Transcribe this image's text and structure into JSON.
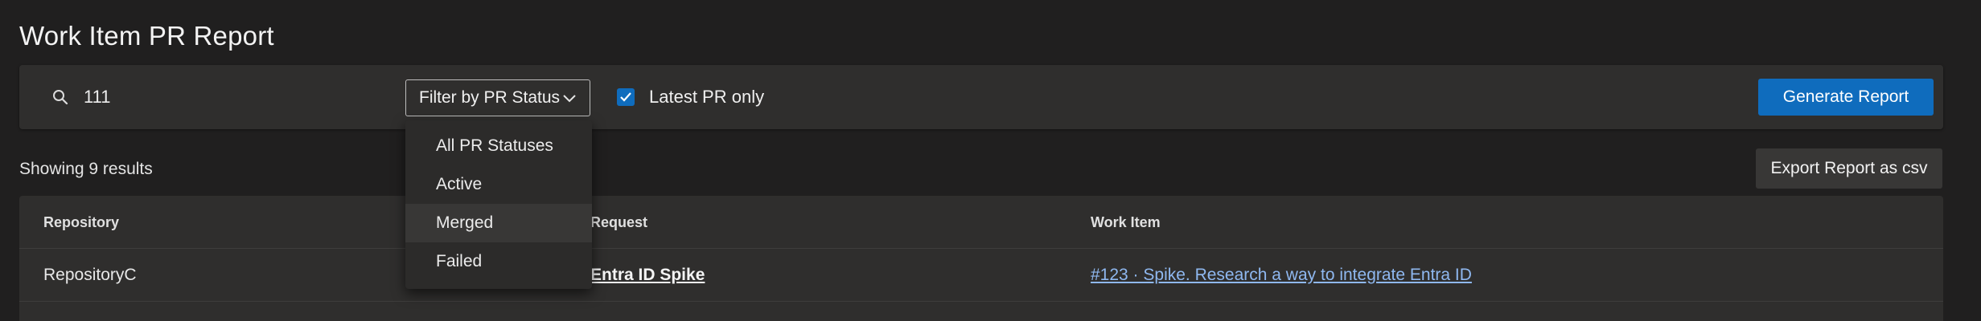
{
  "page": {
    "title": "Work Item PR Report"
  },
  "filters": {
    "search_value": "111",
    "search_icon": "search-icon",
    "status_dropdown_label": "Filter by PR Status",
    "latest_only_label": "Latest PR only",
    "latest_only_checked": true,
    "generate_label": "Generate Report"
  },
  "results": {
    "count_text": "Showing 9 results",
    "export_label": "Export Report as csv"
  },
  "table": {
    "headers": [
      "Repository",
      "Pull Request",
      "Work Item"
    ],
    "rows": [
      {
        "repository": "RepositoryC",
        "pull_request": "Entra ID Spike",
        "work_item": "#123 · Spike. Research a way to integrate Entra ID"
      }
    ]
  },
  "status_menu": {
    "options": [
      "All PR Statuses",
      "Active",
      "Merged",
      "Failed"
    ],
    "hovered": "Merged"
  },
  "colors": {
    "accent": "#0f6cbd",
    "link": "#8fb8f0",
    "background": "#201f1f",
    "surface": "#2f2e2d"
  }
}
